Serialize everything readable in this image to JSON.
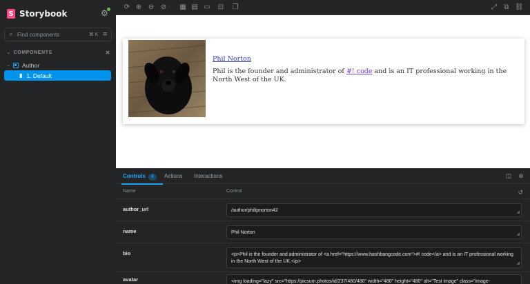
{
  "app": {
    "name": "Storybook",
    "logo_letter": "S"
  },
  "sidebar": {
    "search_placeholder": "Find components",
    "search_shortcut": "⌘ K",
    "section_title": "COMPONENTS",
    "tree": {
      "component": "Author",
      "story": "1. Default"
    }
  },
  "preview": {
    "author_name": "Phil Norton",
    "bio_before": "Phil is the founder and administrator of ",
    "bio_link": "#! code",
    "bio_after": " and is an IT professional working in the North West of the UK."
  },
  "panel": {
    "tabs": [
      {
        "label": "Controls",
        "badge": "4"
      },
      {
        "label": "Actions"
      },
      {
        "label": "Interactions"
      }
    ],
    "columns": {
      "name": "Name",
      "control": "Control"
    },
    "rows": [
      {
        "name": "author_url",
        "value": "/author/philipnorton42"
      },
      {
        "name": "name",
        "value": "Phil Norton"
      },
      {
        "name": "bio",
        "value": "<p>Phil is the founder and administrator of <a href=\"https://www.hashbangcode.com\">#! code</a> and is an IT professional working in the North West of the UK.</p>"
      },
      {
        "name": "avatar",
        "value": "<img loading=\"lazy\" src=\"https://picsum.photos/id/237/480/480\" width=\"480\" height=\"480\" alt=\"Test image\" class=\"image-"
      }
    ]
  },
  "icons": {
    "settings": "gear-icon",
    "search": "search-icon",
    "filter": "filter-icon",
    "zoom_in": "zoom-in-icon",
    "zoom_out": "zoom-out-icon",
    "reset_zoom": "reset-zoom-icon",
    "grid": "grid-icon",
    "measure": "measure-icon",
    "outline": "outline-icon",
    "fullscreen": "fullscreen-icon",
    "new_tab": "open-new-tab-icon",
    "copy_link": "link-icon"
  },
  "colors": {
    "accent": "#1ea7fd",
    "brand": "#ff4785",
    "selected": "#0294ec",
    "status_dot": "#66bf3c"
  }
}
